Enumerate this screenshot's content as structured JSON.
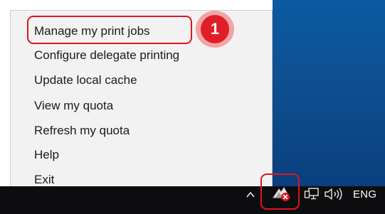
{
  "context_menu": {
    "items": [
      {
        "label": "Manage my print jobs"
      },
      {
        "label": "Configure delegate printing"
      },
      {
        "label": "Update local cache"
      },
      {
        "label": "View my quota"
      },
      {
        "label": "Refresh my quota"
      },
      {
        "label": "Help"
      },
      {
        "label": "Exit"
      }
    ]
  },
  "callout": {
    "step_number": "1"
  },
  "taskbar": {
    "language": "ENG",
    "tray_icons": [
      "chevron-up-icon",
      "print-client-icon",
      "network-icon",
      "volume-icon"
    ]
  },
  "colors": {
    "highlight_red": "#e0141e",
    "badge_red": "#e01e27",
    "menu_background": "#f2f2f2",
    "taskbar_background": "#0d0d0f",
    "desktop_blue": "#0e4f90"
  }
}
